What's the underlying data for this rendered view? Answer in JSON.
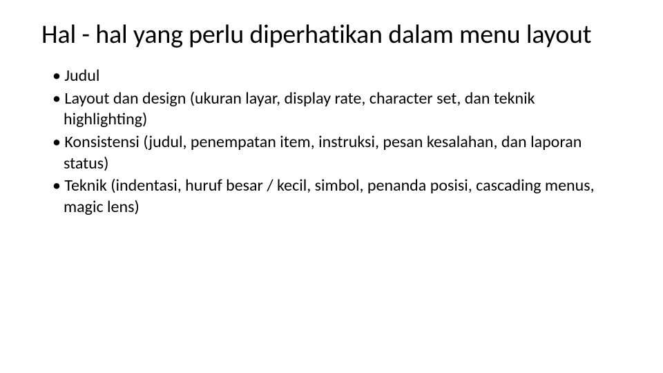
{
  "title": "Hal - hal yang perlu diperhatikan dalam menu layout",
  "bullets": [
    "Judul",
    "Layout dan design (ukuran layar, display rate, character set, dan teknik highlighting)",
    "Konsistensi (judul, penempatan item, instruksi, pesan kesalahan, dan laporan status)",
    "Teknik (indentasi, huruf besar / kecil, simbol, penanda posisi, cascading menus, magic lens)"
  ]
}
